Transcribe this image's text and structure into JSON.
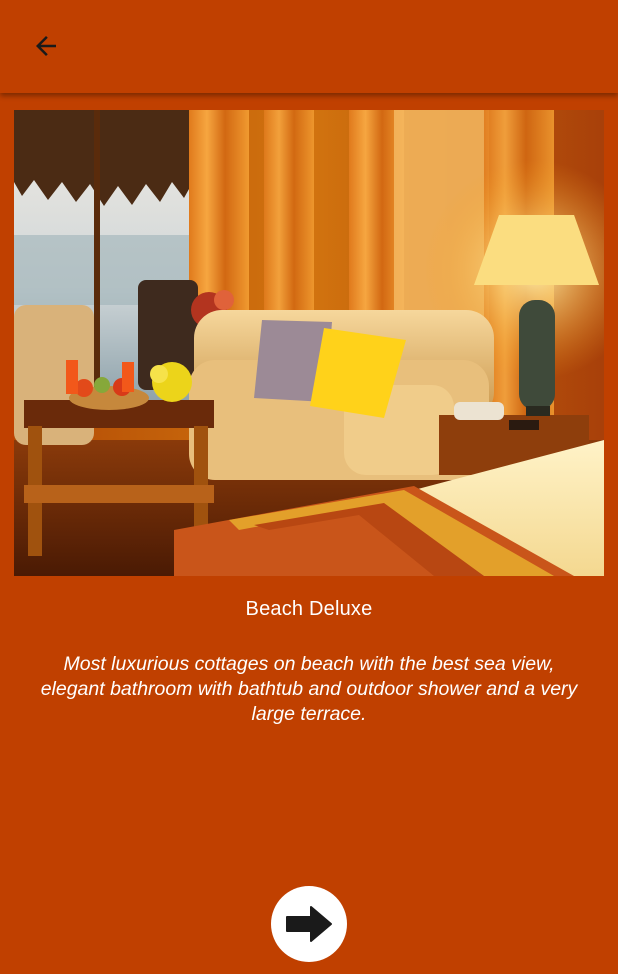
{
  "app_bar": {
    "back_icon": "arrow-back-icon"
  },
  "hero_image": {
    "alt": "Beach Deluxe room interior"
  },
  "room": {
    "title": "Beach Deluxe",
    "description": "Most luxurious cottages on beach with the best sea view, elegant bathroom with bathtub and outdoor shower and a very large terrace."
  },
  "next_button": {
    "icon": "arrow-right-icon"
  },
  "colors": {
    "background": "#C04000",
    "text": "#FFFFFF",
    "button_bg": "#FFFFFF",
    "icon_dark": "#1a1a1a"
  }
}
